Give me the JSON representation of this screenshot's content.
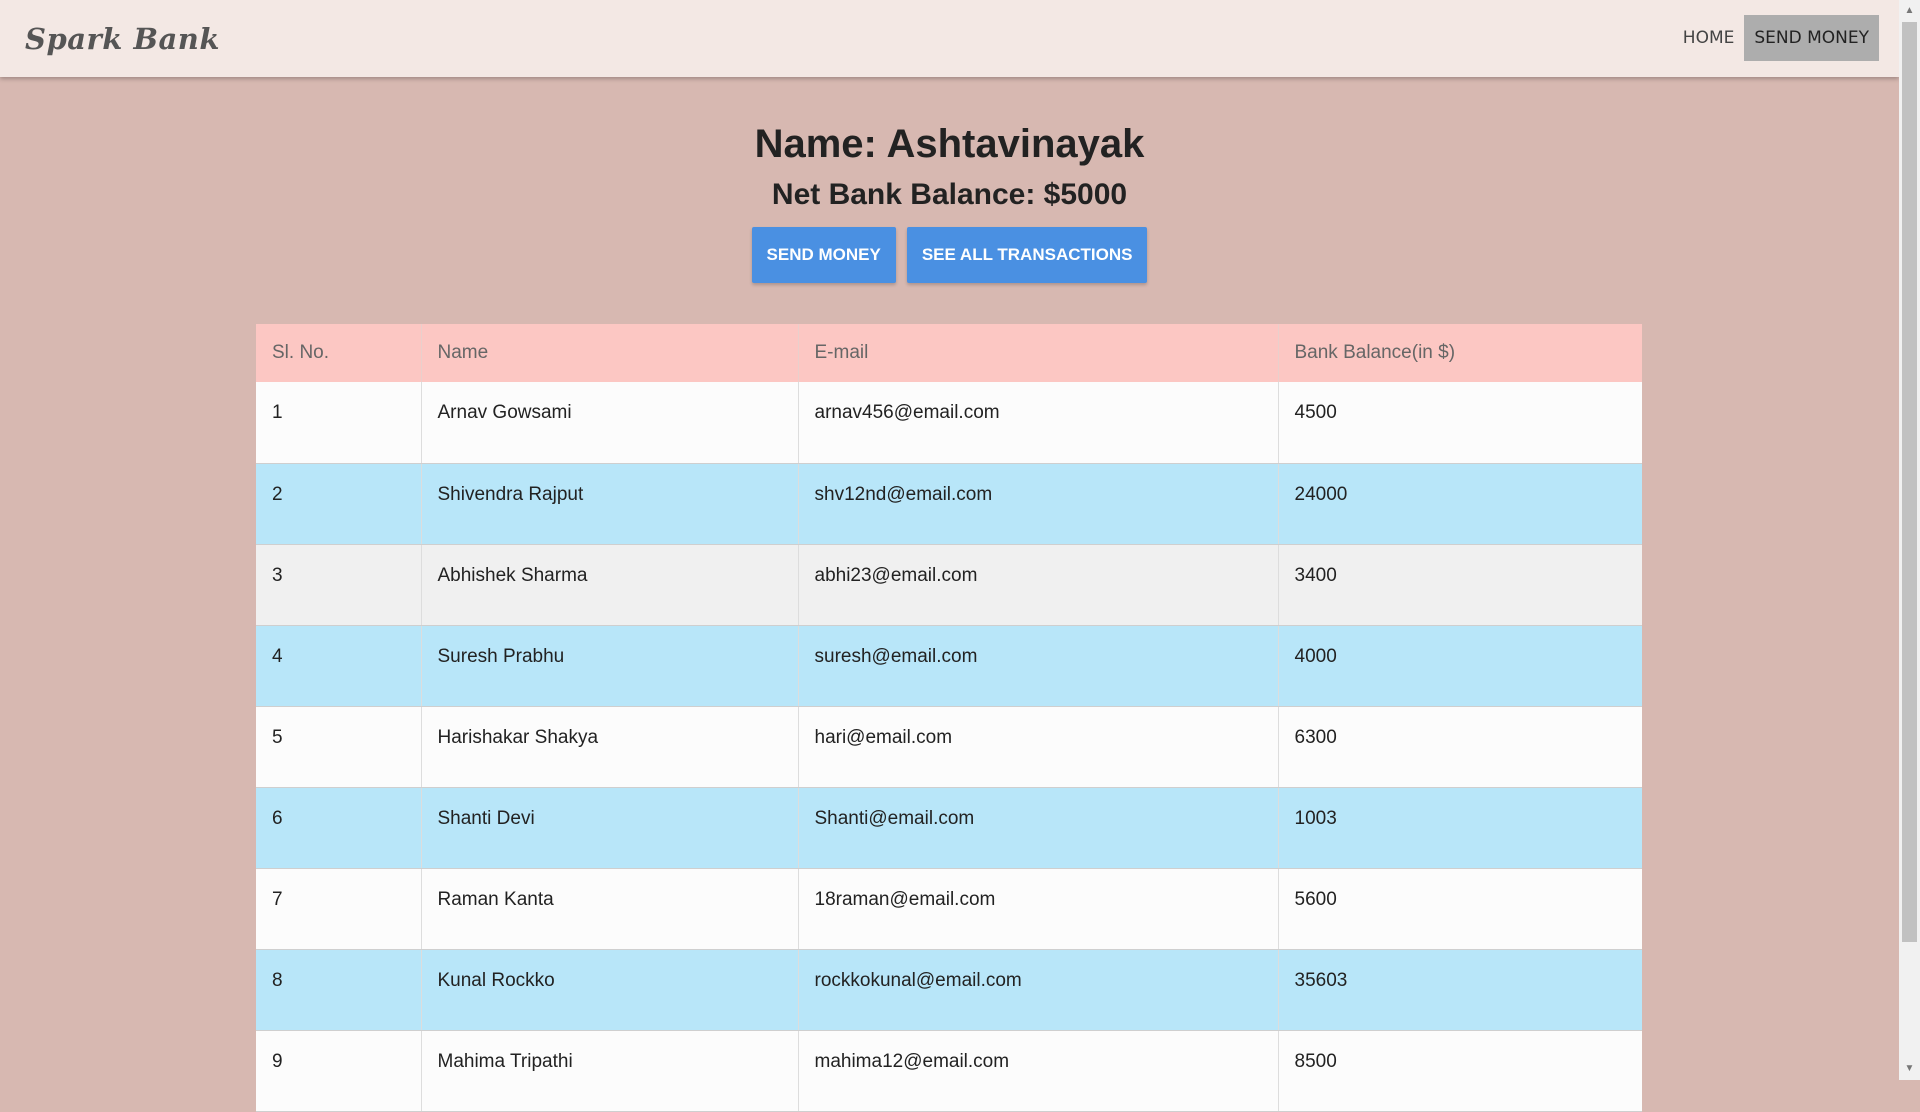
{
  "navbar": {
    "brand": "Spark Bank",
    "links": [
      {
        "label": "HOME"
      },
      {
        "label": "SEND MONEY"
      }
    ]
  },
  "customer": {
    "name_line": "Name: Ashtavinayak",
    "balance_line": "Net Bank Balance: $5000"
  },
  "actions": {
    "send_money": "SEND MONEY",
    "see_transactions": "SEE ALL TRANSACTIONS"
  },
  "table": {
    "headers": [
      "Sl. No.",
      "Name",
      "E-mail",
      "Bank Balance(in $)"
    ],
    "rows": [
      [
        "1",
        "Arnav Gowsami",
        "arnav456@email.com",
        "4500"
      ],
      [
        "2",
        "Shivendra Rajput",
        "shv12nd@email.com",
        "24000"
      ],
      [
        "3",
        "Abhishek Sharma",
        "abhi23@email.com",
        "3400"
      ],
      [
        "4",
        "Suresh Prabhu",
        "suresh@email.com",
        "4000"
      ],
      [
        "5",
        "Harishakar Shakya",
        "hari@email.com",
        "6300"
      ],
      [
        "6",
        "Shanti Devi",
        "Shanti@email.com",
        "1003"
      ],
      [
        "7",
        "Raman Kanta",
        "18raman@email.com",
        "5600"
      ],
      [
        "8",
        "Kunal Rockko",
        "rockkokunal@email.com",
        "35603"
      ],
      [
        "9",
        "Mahima Tripathi",
        "mahima12@email.com",
        "8500"
      ]
    ]
  },
  "colors": {
    "page_bg": "#d7b8b1",
    "navbar_bg": "#f3e8e4",
    "header_row": "#fcc7c3",
    "row_blue": "#b8e6f9",
    "row_grey": "#f0f0f0",
    "button": "#4a90e2"
  },
  "icons": {
    "scroll_up": "▲",
    "scroll_down": "▼"
  }
}
